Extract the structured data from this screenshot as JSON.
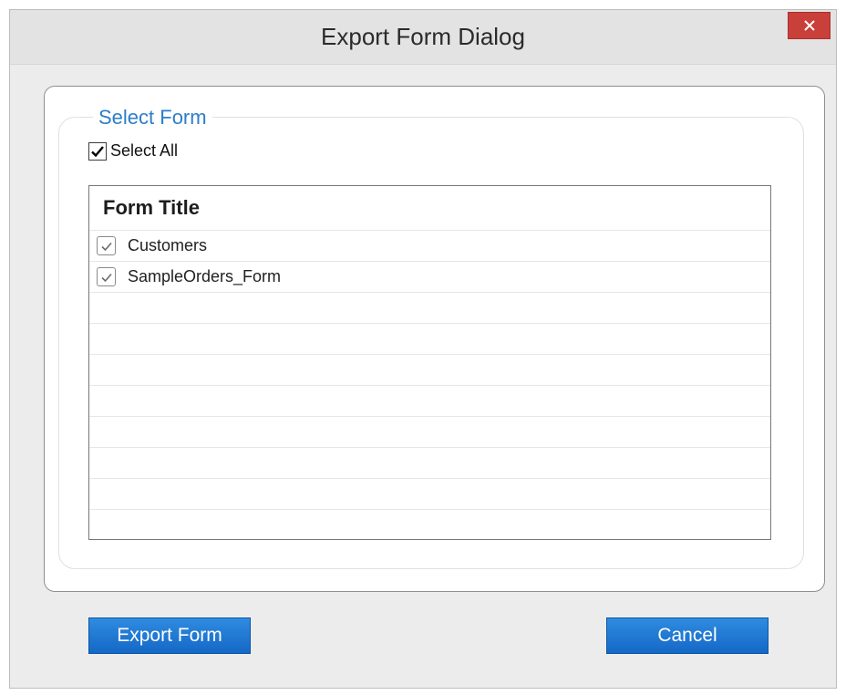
{
  "window": {
    "title": "Export Form Dialog"
  },
  "select_form": {
    "legend": "Select Form",
    "select_all_label": "Select All",
    "select_all_checked": true
  },
  "grid": {
    "header": "Form Title",
    "rows": [
      {
        "label": "Customers",
        "checked": true
      },
      {
        "label": "SampleOrders_Form",
        "checked": true
      }
    ],
    "empty_row_count": 8
  },
  "buttons": {
    "export_label": "Export Form",
    "cancel_label": "Cancel"
  },
  "colors": {
    "accent": "#2c7ec9",
    "button_blue": "#1a72d4",
    "close_red": "#c9403a"
  }
}
